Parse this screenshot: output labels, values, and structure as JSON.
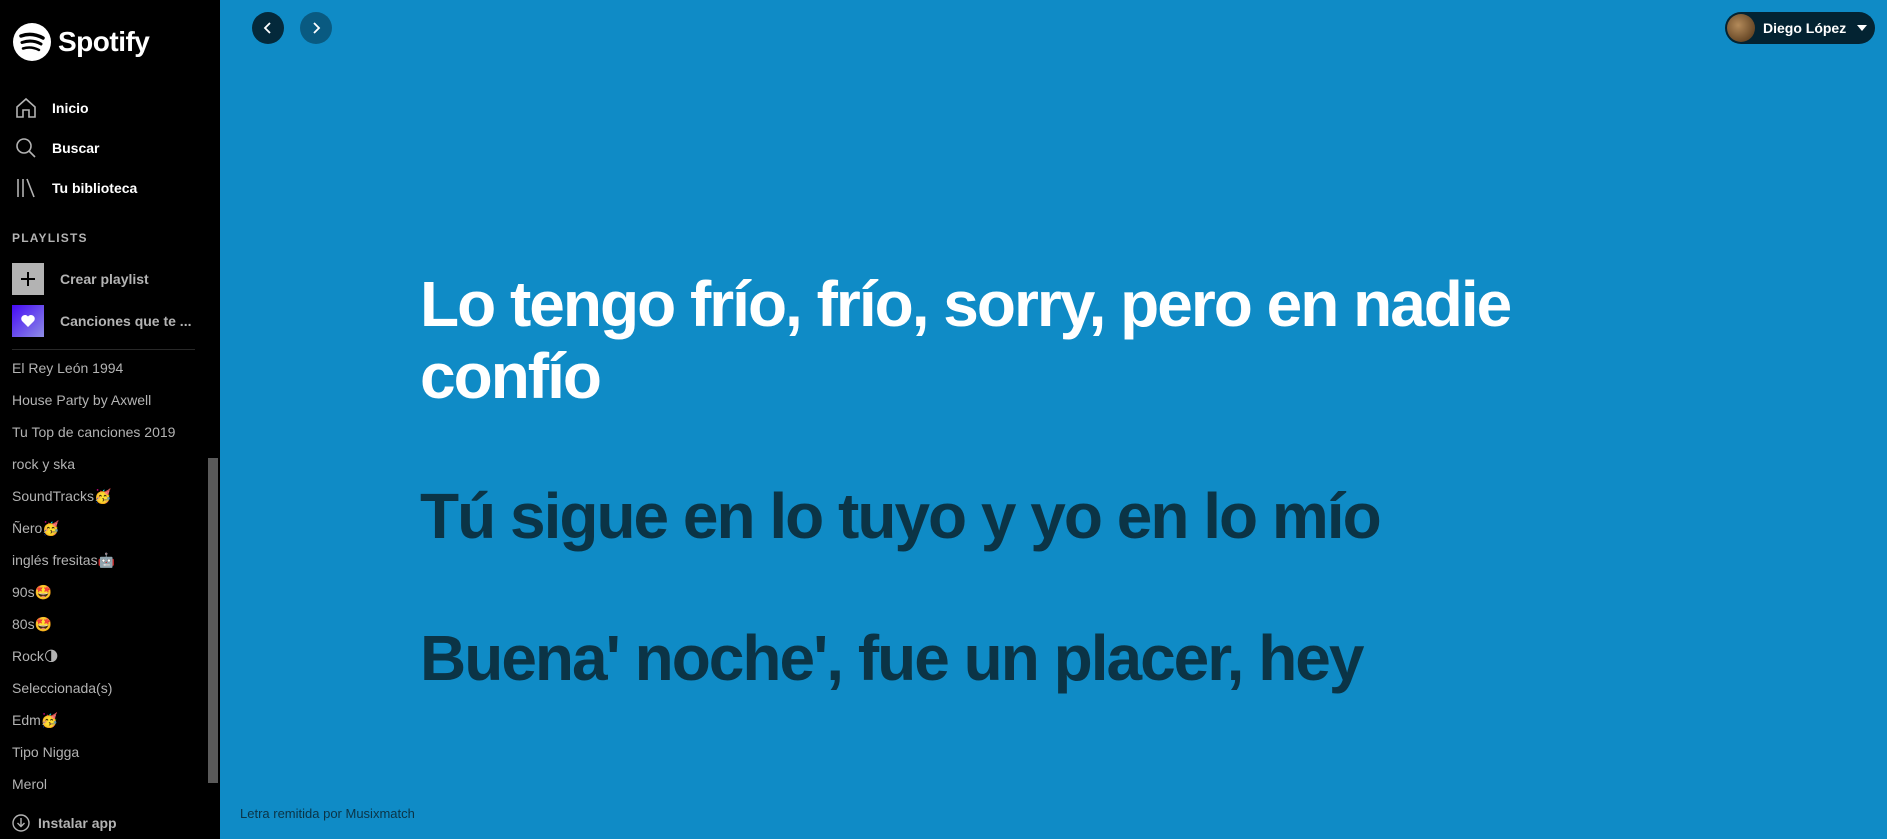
{
  "app": {
    "name": "Spotify"
  },
  "nav": {
    "items": [
      {
        "label": "Inicio",
        "icon": "home-icon"
      },
      {
        "label": "Buscar",
        "icon": "search-icon"
      },
      {
        "label": "Tu biblioteca",
        "icon": "library-icon"
      }
    ]
  },
  "sidebar": {
    "section_title": "PLAYLISTS",
    "create_label": "Crear playlist",
    "liked_label": "Canciones que te ...",
    "playlists": [
      "El Rey León 1994",
      "House Party by Axwell",
      "Tu Top de canciones 2019",
      "rock y ska",
      "SoundTracks🥳",
      "Ñero🥳",
      "inglés fresitas🤖",
      "90s🤩",
      "80s🤩",
      "Rock🌗",
      "Seleccionada(s)",
      "Edm🥳",
      "Tipo Nigga",
      "Merol"
    ],
    "install_label": "Instalar app"
  },
  "header": {
    "user_name": "Diego López"
  },
  "lyrics": {
    "current": "Lo tengo frío, frío, sorry, pero en nadie confío",
    "next": "Tú sigue en lo tuyo y yo en lo mío",
    "next2": "Buena' noche', fue un placer, hey"
  },
  "footer": {
    "credit": "Letra remitida por Musixmatch"
  },
  "colors": {
    "background": "#0f8bc6",
    "inactive_lyric": "#0b3446",
    "sidebar": "#000000"
  }
}
